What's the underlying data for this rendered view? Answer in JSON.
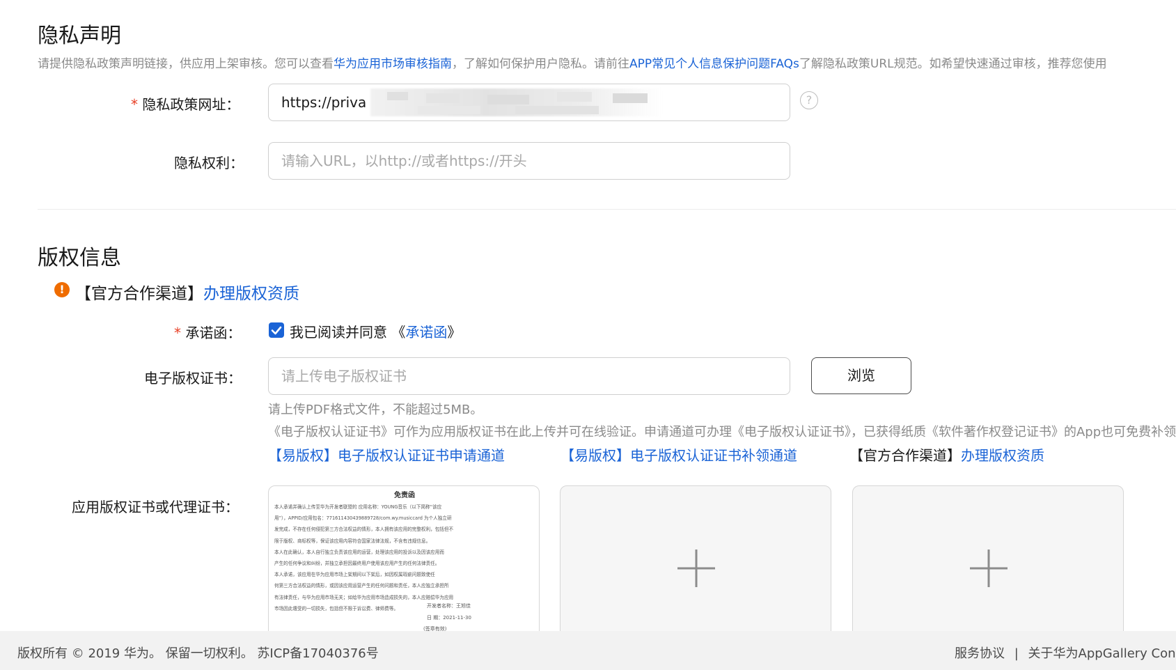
{
  "privacy": {
    "title": "隐私声明",
    "desc_part1": "请提供隐私政策声明链接，供应用上架审核。您可以查看",
    "desc_link1": "华为应用市场审核指南",
    "desc_part2": "，了解如何保护用户隐私。请前往",
    "desc_link2": "APP常见个人信息保护问题FAQs",
    "desc_part3": "了解隐私政策URL规范。如希望快速通过审核，推荐您使用",
    "policy_url_label": "隐私政策网址：",
    "policy_url_value": "https://priva",
    "rights_label": "隐私权利：",
    "rights_placeholder": "请输入URL，以http://或者https://开头"
  },
  "copyright": {
    "title": "版权信息",
    "notice_prefix": "【官方合作渠道】",
    "notice_link": "办理版权资质",
    "pledge_label": "承诺函：",
    "pledge_checked": true,
    "pledge_text": "我已阅读并同意 《",
    "pledge_link": "承诺函",
    "pledge_close": "》",
    "ecert_label": "电子版权证书：",
    "ecert_placeholder": "请上传电子版权证书",
    "browse_button": "浏览",
    "hint1": "请上传PDF格式文件，不能超过5MB。",
    "hint2": "《电子版权认证证书》可作为应用版权证书在此上传并可在线验证。申请通道可办理《电子版权认证证书》，已获得纸质《软件著作权登记证书》的App也可免费补领",
    "link_apply": "【易版权】电子版权认证证书申请通道",
    "link_reissue": "【易版权】电子版权认证证书补领通道",
    "link_official_prefix": "【官方合作渠道】",
    "link_official": "办理版权资质",
    "app_cert_label": "应用版权证书或代理证书：",
    "doc_preview": {
      "title": "免责函",
      "lines": [
        "本人承诺并确认上传至华为开发者联盟的 应用名称：YOUNG音乐（以下简称“该应",
        "用”），APPID/应用包名：771611430439889728/com.wy.musiccard 为个人独立研",
        "发完成，不存在任何侵犯第三方合法权益的情形，本人拥有该应用的完整权利，包括但不",
        "限于版权、商标权等，保证该应用内容符合国家法律法规，不含有违规信息。",
        "本人在此确认，本人自行独立负责该应用的运营，处理该应用的投诉以及因该应用而",
        "产生的任何争议和纠纷，并独立承担因最终用户使用该应用产生的任何法律责任。",
        "本人承诺，该应用在华为应用市场上架期间以下架后，如因权属瑕疵问题致使任",
        "何第三方合法权益的情形，或因该应用运营产生的任何问题和责任，本人应独立承担所",
        "有法律责任，与华为应用市场无关；如给华为应用市场造成损失的，本人应赔偿华为应用",
        "市场因此遭受的一切损失，包括但不限于诉讼费、律师费等。"
      ],
      "signer": "开发者名称：王旭佳",
      "date": "日  期：2021-11-30",
      "seal": "(签章有效)"
    },
    "add_symbol": "+"
  },
  "footer": {
    "copyright": "版权所有 © 2019 华为。 保留一切权利。 苏ICP备17040376号",
    "service_agreement": "服务协议",
    "separator": "|",
    "about": "关于华为AppGallery Conn"
  },
  "icons": {
    "help": "?",
    "alert": "!",
    "check": "check-icon"
  },
  "colors": {
    "link": "#1a63d6",
    "required": "#e84026",
    "alert": "#ef6c00",
    "checkbox": "#1a63d6"
  }
}
